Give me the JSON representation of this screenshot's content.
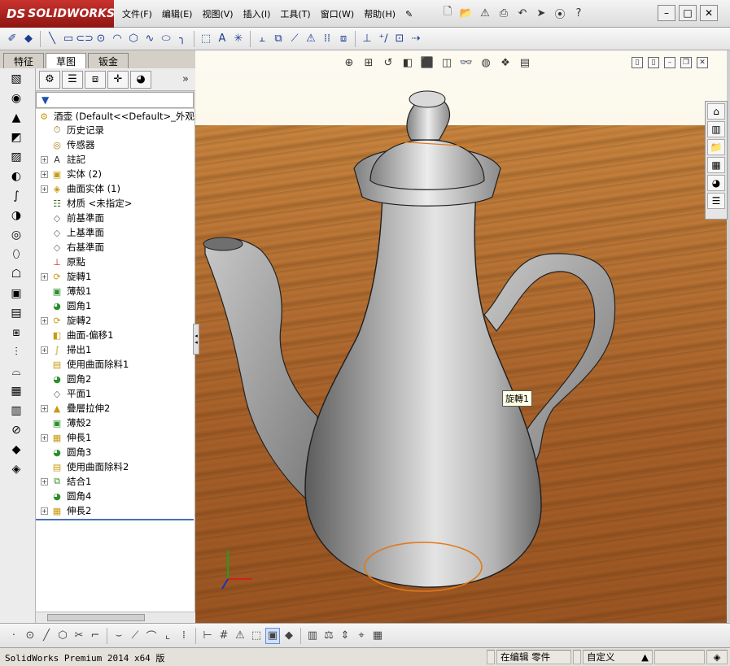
{
  "app": {
    "logo_mark": "DS",
    "logo_text": "SOLIDWORKS"
  },
  "menu": [
    "文件(F)",
    "编辑(E)",
    "视图(V)",
    "插入(I)",
    "工具(T)",
    "窗口(W)",
    "帮助(H)"
  ],
  "command_tabs": [
    "特征",
    "草图",
    "钣金"
  ],
  "active_tab": "草图",
  "feature_tree": {
    "root": "酒壶  (Default<<Default>_外观",
    "items": [
      {
        "label": "历史记录",
        "icon": "history-icon",
        "expandable": false
      },
      {
        "label": "传感器",
        "icon": "sensor-icon",
        "expandable": false
      },
      {
        "label": "註記",
        "icon": "annotation-icon",
        "expandable": true
      },
      {
        "label": "实体 (2)",
        "icon": "solid-bodies-icon",
        "expandable": true
      },
      {
        "label": "曲面实体 (1)",
        "icon": "surface-bodies-icon",
        "expandable": true
      },
      {
        "label": "材质 <未指定>",
        "icon": "material-icon",
        "expandable": false
      },
      {
        "label": "前基準面",
        "icon": "plane-icon",
        "expandable": false
      },
      {
        "label": "上基準面",
        "icon": "plane-icon",
        "expandable": false
      },
      {
        "label": "右基準面",
        "icon": "plane-icon",
        "expandable": false
      },
      {
        "label": "原點",
        "icon": "origin-icon",
        "expandable": false
      },
      {
        "label": "旋轉1",
        "icon": "revolve-icon",
        "expandable": true
      },
      {
        "label": "薄殼1",
        "icon": "shell-icon",
        "expandable": false
      },
      {
        "label": "圆角1",
        "icon": "fillet-icon",
        "expandable": false
      },
      {
        "label": "旋轉2",
        "icon": "revolve-icon",
        "expandable": true
      },
      {
        "label": "曲面-偏移1",
        "icon": "offset-surface-icon",
        "expandable": false
      },
      {
        "label": "掃出1",
        "icon": "sweep-icon",
        "expandable": true
      },
      {
        "label": "使用曲面除料1",
        "icon": "surface-cut-icon",
        "expandable": false
      },
      {
        "label": "圆角2",
        "icon": "fillet-icon",
        "expandable": false
      },
      {
        "label": "平面1",
        "icon": "plane-icon",
        "expandable": false
      },
      {
        "label": "疊層拉伸2",
        "icon": "loft-icon",
        "expandable": true
      },
      {
        "label": "薄殼2",
        "icon": "shell-icon",
        "expandable": false
      },
      {
        "label": "伸長1",
        "icon": "extrude-icon",
        "expandable": true
      },
      {
        "label": "圆角3",
        "icon": "fillet-icon",
        "expandable": false
      },
      {
        "label": "使用曲面除料2",
        "icon": "surface-cut-icon",
        "expandable": false
      },
      {
        "label": "結合1",
        "icon": "combine-icon",
        "expandable": true
      },
      {
        "label": "圆角4",
        "icon": "fillet-icon",
        "expandable": false
      },
      {
        "label": "伸長2",
        "icon": "extrude-icon",
        "expandable": true
      }
    ]
  },
  "viewport": {
    "tooltip": "旋轉1"
  },
  "status": {
    "app": "SolidWorks Premium 2014 x64 版",
    "mode": "在编辑 零件",
    "units": "自定义"
  },
  "colors": {
    "logo_red": "#b3241f",
    "selection_orange": "#e07a1a",
    "tree_separator": "#4a6fb5"
  }
}
